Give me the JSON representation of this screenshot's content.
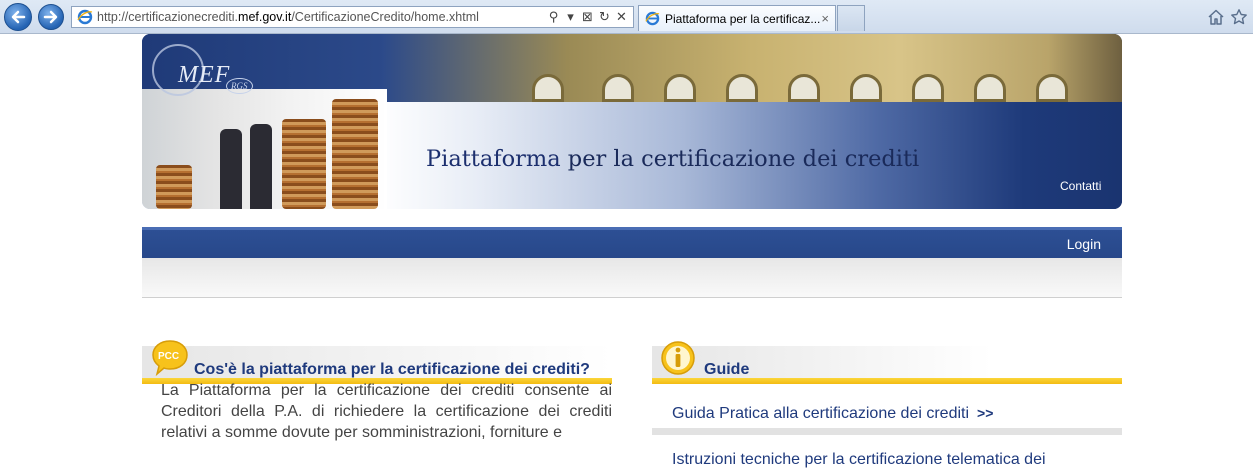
{
  "browser": {
    "url_prefix": "http://certificazionecrediti.",
    "url_domain": "mef.gov.it",
    "url_path": "/CertificazioneCredito/home.xhtml",
    "tab_title": "Piattaforma per la certificaz...",
    "tab_close": "×",
    "addr_tools": [
      "⚲",
      "▾",
      "⊠",
      "↻",
      "✕"
    ]
  },
  "banner": {
    "logo_text": "MEF",
    "logo_sub": "RGS",
    "title_highlight": "Piattaforma",
    "title_rest": " per la certificazione dei crediti",
    "contact_link": "Contatti"
  },
  "nav": {
    "login": "Login"
  },
  "about": {
    "badge": "PCC",
    "heading": "Cos'è la piattaforma per la certificazione dei crediti?",
    "text": "La Piattaforma per la certificazione dei crediti consente ai Creditori della P.A. di richiedere la certificazione dei crediti relativi a somme dovute per somministrazioni, forniture e"
  },
  "guides": {
    "heading": "Guide",
    "items": [
      {
        "label": "Guida Pratica alla certificazione dei crediti",
        "arrow": ">>"
      },
      {
        "label": "Istruzioni tecniche per la certificazione telematica dei",
        "arrow": ""
      }
    ]
  },
  "colors": {
    "brand_blue": "#1f3a7d",
    "accent_yellow": "#f3bb12",
    "nav_blue": "#2d4f94"
  }
}
